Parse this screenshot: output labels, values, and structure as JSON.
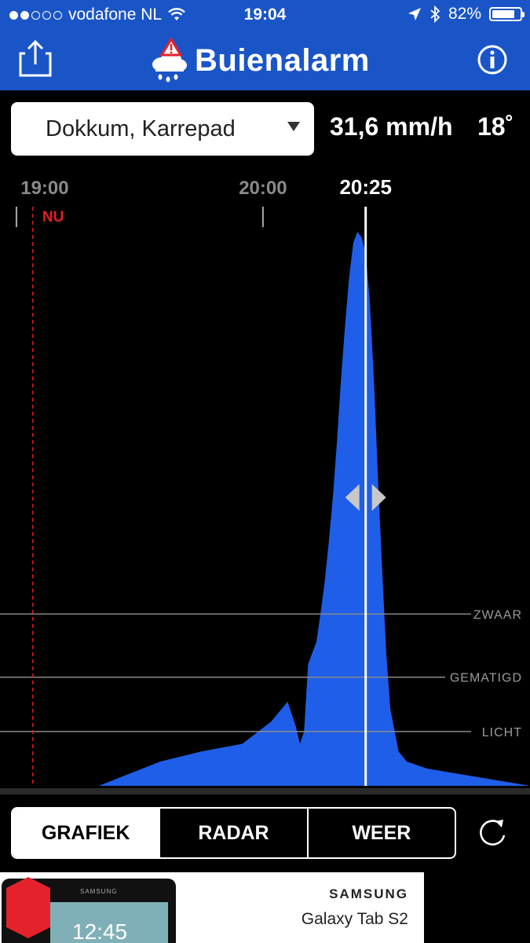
{
  "status_bar": {
    "carrier": "vodafone NL",
    "time": "19:04",
    "battery": "82%",
    "battery_level": 0.82,
    "signal_bars_filled": 2,
    "signal_bars_total": 5
  },
  "header": {
    "app_name": "Buienalarm",
    "share_icon": "share-icon",
    "info_icon": "info-icon",
    "logo_icon": "rain-cloud-alert-icon"
  },
  "location": {
    "selected": "Dokkum, Karrepad"
  },
  "readout": {
    "rain_rate": "31,6 mm/h",
    "temperature": "18˚"
  },
  "chart_data": {
    "type": "area",
    "title": "",
    "xlabel": "",
    "ylabel": "",
    "x_tick_labels": [
      "19:00",
      "20:00"
    ],
    "x_ticks": [
      "19:00",
      "20:00"
    ],
    "now_label": "NU",
    "now_time": "19:04",
    "selected_time": "20:25",
    "cursor_icon": "left-right-arrows-icon",
    "x_range": [
      "18:56",
      "21:05"
    ],
    "threshold_levels": [
      {
        "name": "ZWAAR",
        "value": 5.0
      },
      {
        "name": "GEMATIGD",
        "value": 2.0
      },
      {
        "name": "LICHT",
        "value": 0.5
      }
    ],
    "y_range": [
      0,
      55
    ],
    "series": [
      {
        "x": [
          "18:56",
          "19:05",
          "19:20",
          "19:35",
          "19:45",
          "19:55",
          "20:02",
          "20:06",
          "20:08",
          "20:09",
          "20:10",
          "20:11",
          "20:12",
          "20:13",
          "20:14",
          "20:15",
          "20:16",
          "20:17",
          "20:18",
          "20:19",
          "20:20",
          "20:21",
          "20:22",
          "20:23",
          "20:24",
          "20:25",
          "20:26",
          "20:27",
          "20:28",
          "20:29",
          "20:30",
          "20:31",
          "20:33",
          "20:35",
          "20:40",
          "21:05"
        ],
        "values": [
          0,
          0,
          0,
          0.1,
          0.2,
          0.3,
          0.7,
          1.2,
          0.6,
          0.3,
          0.5,
          2.5,
          3.0,
          3.5,
          5.0,
          7.0,
          10.0,
          14.0,
          20.0,
          28.0,
          36.0,
          44.0,
          50.0,
          52.0,
          51.0,
          48.0,
          40.0,
          28.0,
          16.0,
          8.0,
          3.0,
          1.0,
          0.2,
          0.1,
          0.05,
          0
        ]
      }
    ],
    "fill_color": "#1f5ee8",
    "grid": false
  },
  "tabs": [
    {
      "label": "GRAFIEK",
      "active": true
    },
    {
      "label": "RADAR",
      "active": false
    },
    {
      "label": "WEER",
      "active": false
    }
  ],
  "refresh_icon": "refresh-icon",
  "ad": {
    "brand": "SAMSUNG",
    "model": "Galaxy Tab S2",
    "clock": "12:45",
    "device_brand": "SAMSUNG"
  }
}
